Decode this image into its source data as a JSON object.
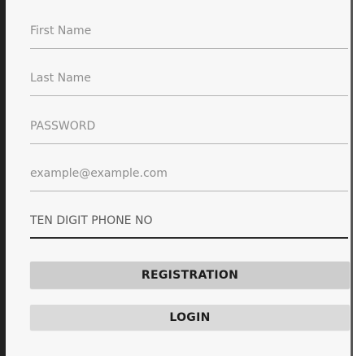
{
  "form": {
    "first_name": {
      "placeholder": "First Name",
      "value": ""
    },
    "last_name": {
      "placeholder": "Last Name",
      "value": ""
    },
    "password": {
      "placeholder": "PASSWORD",
      "value": ""
    },
    "email": {
      "placeholder": "example@example.com",
      "value": ""
    },
    "phone": {
      "placeholder": "TEN DIGIT PHONE NO",
      "value": ""
    }
  },
  "buttons": {
    "registration_label": "REGISTRATION",
    "login_label": "LOGIN"
  },
  "colors": {
    "background": "#f7f7f7",
    "button_registration": "#cdcdcd",
    "button_login": "#dadada",
    "underline": "#b4b4b4",
    "underline_focused": "#2b2b2b"
  }
}
